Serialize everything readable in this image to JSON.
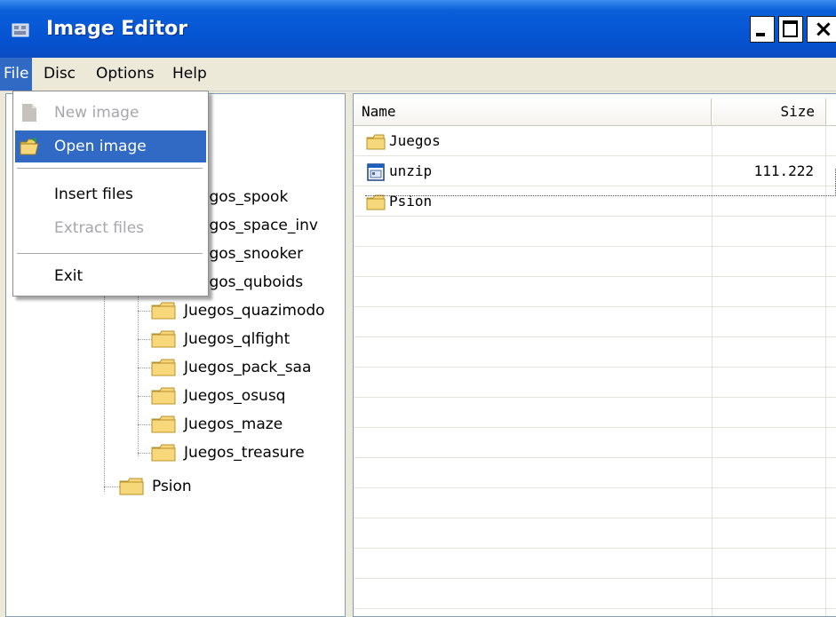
{
  "window": {
    "title": "Image Editor",
    "close_glyph": "×"
  },
  "menubar": {
    "items": [
      "File",
      "Disc",
      "Options",
      "Help"
    ]
  },
  "file_menu": {
    "items": [
      {
        "label": "New image",
        "icon": "document-icon",
        "enabled": false
      },
      {
        "label": "Open image",
        "icon": "open-folder-icon",
        "enabled": true,
        "highlighted": true
      },
      {
        "label": "Insert files",
        "enabled": true
      },
      {
        "label": "Extract files",
        "enabled": false
      },
      {
        "label": "Exit",
        "enabled": true
      }
    ]
  },
  "tree": {
    "partial_label": "s",
    "hidden_items": [
      "egos_spook",
      "egos_space_inv",
      "egos_snooker",
      "egos_quboids"
    ],
    "items": [
      {
        "label": "Juegos_quazimodo"
      },
      {
        "label": "Juegos_qlfight"
      },
      {
        "label": "Juegos_pack_saa"
      },
      {
        "label": "Juegos_osusq"
      },
      {
        "label": "Juegos_maze"
      },
      {
        "label": "Juegos_treasure"
      }
    ],
    "root_sibling": "Psion"
  },
  "list": {
    "columns": {
      "name": "Name",
      "size": "Size"
    },
    "rows": [
      {
        "name": "Juegos",
        "size": "",
        "type": "folder"
      },
      {
        "name": "unzip",
        "size": "111.222",
        "type": "file"
      },
      {
        "name": "Psion",
        "size": "",
        "type": "folder"
      }
    ]
  },
  "colors": {
    "titlebar_blue": "#0655d3",
    "selection": "#316ac5",
    "folder_fill": "#f6d77a",
    "folder_stroke": "#b8902b"
  }
}
